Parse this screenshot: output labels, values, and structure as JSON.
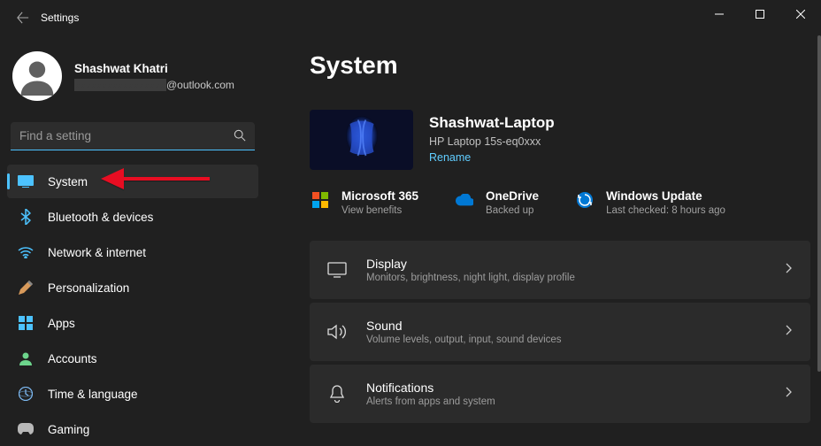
{
  "window": {
    "title": "Settings"
  },
  "user": {
    "name": "Shashwat Khatri",
    "email_suffix": "@outlook.com"
  },
  "search": {
    "placeholder": "Find a setting"
  },
  "nav": [
    {
      "key": "system",
      "label": "System"
    },
    {
      "key": "bluetooth",
      "label": "Bluetooth & devices"
    },
    {
      "key": "network",
      "label": "Network & internet"
    },
    {
      "key": "personalization",
      "label": "Personalization"
    },
    {
      "key": "apps",
      "label": "Apps"
    },
    {
      "key": "accounts",
      "label": "Accounts"
    },
    {
      "key": "time",
      "label": "Time & language"
    },
    {
      "key": "gaming",
      "label": "Gaming"
    }
  ],
  "main": {
    "title": "System",
    "device": {
      "name": "Shashwat-Laptop",
      "model": "HP Laptop 15s-eq0xxx",
      "rename": "Rename"
    },
    "status": [
      {
        "title": "Microsoft 365",
        "sub": "View benefits"
      },
      {
        "title": "OneDrive",
        "sub": "Backed up"
      },
      {
        "title": "Windows Update",
        "sub": "Last checked: 8 hours ago"
      }
    ],
    "cards": [
      {
        "title": "Display",
        "sub": "Monitors, brightness, night light, display profile"
      },
      {
        "title": "Sound",
        "sub": "Volume levels, output, input, sound devices"
      },
      {
        "title": "Notifications",
        "sub": "Alerts from apps and system"
      }
    ]
  }
}
